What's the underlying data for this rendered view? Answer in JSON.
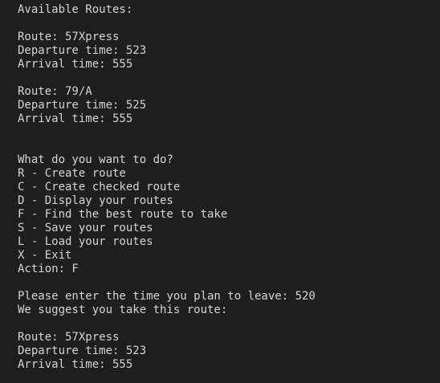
{
  "terminal": {
    "lines": [
      "Available Routes:",
      "",
      "Route: 57Xpress",
      "Departure time: 523",
      "Arrival time: 555",
      "",
      "Route: 79/A",
      "Departure time: 525",
      "Arrival time: 555",
      "",
      "",
      "What do you want to do?",
      "R - Create route",
      "C - Create checked route",
      "D - Display your routes",
      "F - Find the best route to take",
      "S - Save your routes",
      "L - Load your routes",
      "X - Exit",
      "Action: F",
      "",
      "Please enter the time you plan to leave: 520",
      "We suggest you take this route:",
      "",
      "Route: 57Xpress",
      "Departure time: 523",
      "Arrival time: 555"
    ]
  },
  "colors": {
    "background": "#1e1e1e",
    "text": "#d4d4d4"
  }
}
